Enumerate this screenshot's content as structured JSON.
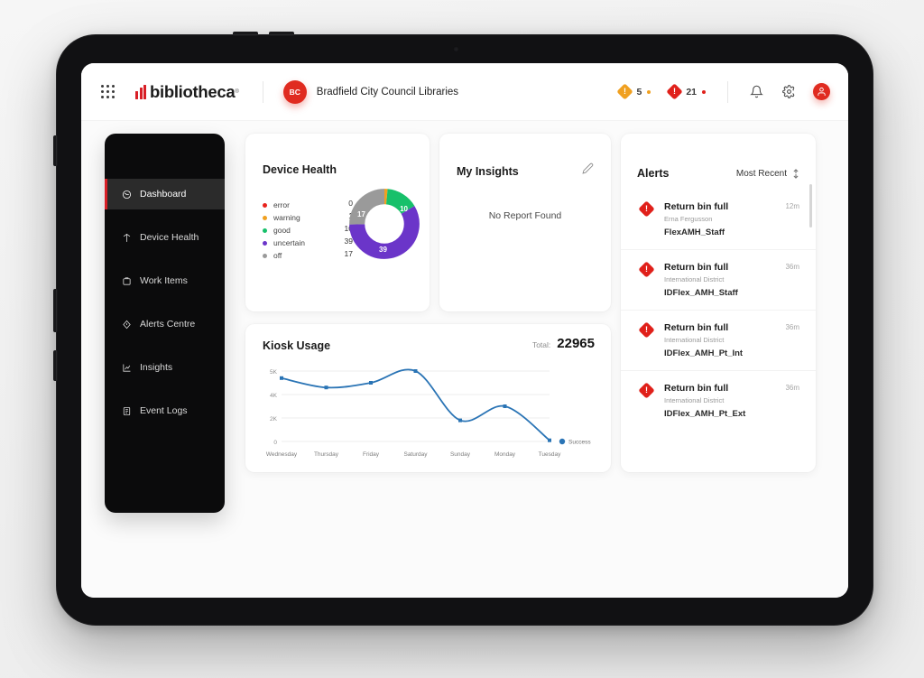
{
  "header": {
    "apps_icon": "grid-apps-icon",
    "brand": "bibliotheca",
    "brand_reg": "®",
    "tenant_initials": "BC",
    "tenant_name": "Bradfield City Council Libraries",
    "warning_badge": {
      "icon": "warning-diamond-icon",
      "glyph": "!",
      "count": "5",
      "color": "#f0a020"
    },
    "error_badge": {
      "icon": "error-diamond-icon",
      "glyph": "!",
      "count": "21",
      "color": "#e0201a"
    },
    "bell_icon": "notification-bell-icon",
    "gear_icon": "settings-gear-icon",
    "avatar_icon": "user-avatar-icon"
  },
  "sidebar": {
    "items": [
      {
        "label": "Dashboard",
        "icon": "gauge-icon",
        "active": true
      },
      {
        "label": "Device Health",
        "icon": "pulse-icon",
        "active": false
      },
      {
        "label": "Work Items",
        "icon": "box-icon",
        "active": false
      },
      {
        "label": "Alerts Centre",
        "icon": "alert-gem-icon",
        "active": false
      },
      {
        "label": "Insights",
        "icon": "chart-icon",
        "active": false
      },
      {
        "label": "Event Logs",
        "icon": "document-icon",
        "active": false
      }
    ]
  },
  "device_health": {
    "title": "Device Health",
    "legend": [
      {
        "name": "error",
        "value": "0",
        "color": "#e8221c"
      },
      {
        "name": "warning",
        "value": "1",
        "color": "#f0a020"
      },
      {
        "name": "good",
        "value": "10",
        "color": "#17c06a"
      },
      {
        "name": "uncertain",
        "value": "39",
        "color": "#6b35c9"
      },
      {
        "name": "off",
        "value": "17",
        "color": "#9a9a9a"
      }
    ],
    "slice_labels": {
      "good": "10",
      "uncertain": "39",
      "off": "17"
    }
  },
  "insights": {
    "title": "My Insights",
    "edit_icon": "pencil-edit-icon",
    "empty_message": "No Report Found"
  },
  "alerts": {
    "title": "Alerts",
    "sort_label": "Most Recent",
    "sort_icon": "sort-updown-icon",
    "items": [
      {
        "title": "Return bin full",
        "location": "Erna Fergusson",
        "device": "FlexAMH_Staff",
        "time": "12m"
      },
      {
        "title": "Return bin full",
        "location": "International District",
        "device": "IDFlex_AMH_Staff",
        "time": "36m"
      },
      {
        "title": "Return bin full",
        "location": "International District",
        "device": "IDFlex_AMH_Pt_Int",
        "time": "36m"
      },
      {
        "title": "Return bin full",
        "location": "International District",
        "device": "IDFlex_AMH_Pt_Ext",
        "time": "36m"
      }
    ]
  },
  "kiosk": {
    "title": "Kiosk Usage",
    "total_label": "Total:",
    "total_value": "22965"
  },
  "chart_data": [
    {
      "type": "pie",
      "title": "Device Health",
      "labels": [
        "error",
        "warning",
        "good",
        "uncertain",
        "off"
      ],
      "values": [
        0,
        1,
        10,
        39,
        17
      ],
      "colors": [
        "#e8221c",
        "#f0a020",
        "#17c06a",
        "#6b35c9",
        "#9a9a9a"
      ],
      "donut": true,
      "legend": "left"
    },
    {
      "type": "line",
      "title": "Kiosk Usage",
      "categories": [
        "Wednesday",
        "Thursday",
        "Friday",
        "Saturday",
        "Sunday",
        "Monday",
        "Tuesday"
      ],
      "series": [
        {
          "name": "Success",
          "values": [
            4700,
            4300,
            4500,
            5000,
            1800,
            3000,
            100
          ],
          "color": "#2a74b5"
        }
      ],
      "yticks": [
        "0",
        "2K",
        "4K",
        "5K"
      ],
      "ytick_values": [
        0,
        2000,
        4000,
        5000
      ],
      "ylim": [
        0,
        5400
      ],
      "xlabel": "",
      "ylabel": "",
      "grid": true,
      "legend": "right",
      "total": 22965
    }
  ]
}
